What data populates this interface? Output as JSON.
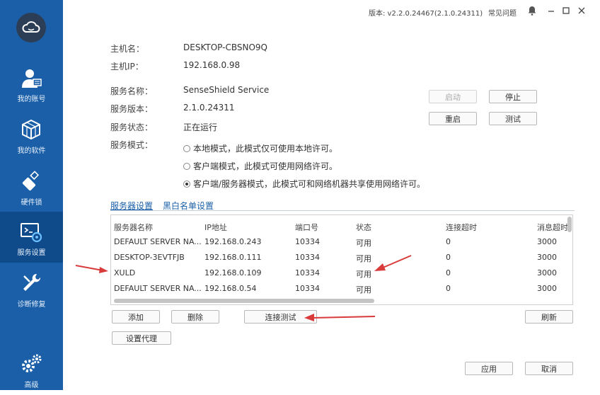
{
  "titlebar": {
    "version": "版本: v2.2.0.24467(2.1.0.24311)",
    "faq": "常见问题"
  },
  "sidebar": {
    "items": [
      {
        "label": "我的账号",
        "icon": "user-icon"
      },
      {
        "label": "我的软件",
        "icon": "cube-icon"
      },
      {
        "label": "硬件锁",
        "icon": "usb-key-icon"
      },
      {
        "label": "服务设置",
        "icon": "service-settings-icon",
        "active": true
      },
      {
        "label": "诊断修复",
        "icon": "wrench-icon"
      },
      {
        "label": "高级",
        "icon": "gears-icon"
      }
    ]
  },
  "host": {
    "name_label": "主机名：",
    "name_value": "DESKTOP-CBSNO9Q",
    "ip_label": "主机IP：",
    "ip_value": "192.168.0.98"
  },
  "service": {
    "name_label": "服务名称：",
    "name_value": "SenseShield Service",
    "version_label": "服务版本：",
    "version_value": "2.1.0.24311",
    "status_label": "服务状态：",
    "status_value": "正在运行",
    "mode_label": "服务模式：",
    "modes": [
      "本地模式，此模式仅可使用本地许可。",
      "客户端模式，此模式可使用网络许可。",
      "客户端/服务器模式，此模式可和网络机器共享使用网络许可。"
    ],
    "selected_mode_index": 2
  },
  "buttons": {
    "start": "启动",
    "stop": "停止",
    "restart": "重启",
    "test": "测试",
    "add": "添加",
    "delete": "删除",
    "connect_test": "连接测试",
    "refresh": "刷新",
    "proxy": "设置代理",
    "apply": "应用",
    "cancel": "取消"
  },
  "tabs": {
    "server_settings": "服务器设置",
    "blacklist": "黑白名单设置"
  },
  "table": {
    "headers": [
      "服务器名称",
      "IP地址",
      "端口号",
      "状态",
      "连接超时",
      "消息超时"
    ],
    "rows": [
      [
        "DEFAULT SERVER NA...",
        "192.168.0.243",
        "10334",
        "可用",
        "0",
        "3000"
      ],
      [
        "DESKTOP-3EVTFJB",
        "192.168.0.111",
        "10334",
        "可用",
        "0",
        "3000"
      ],
      [
        "XULD",
        "192.168.0.109",
        "10334",
        "可用",
        "0",
        "3000"
      ],
      [
        "DEFAULT SERVER NA...",
        "192.168.0.54",
        "10334",
        "可用",
        "0",
        "3000"
      ]
    ]
  },
  "colors": {
    "sidebar": "#1a5fa8",
    "sidebar_active": "#0f4a8a",
    "link": "#1a5fa8",
    "arrow": "#d93a3a"
  }
}
